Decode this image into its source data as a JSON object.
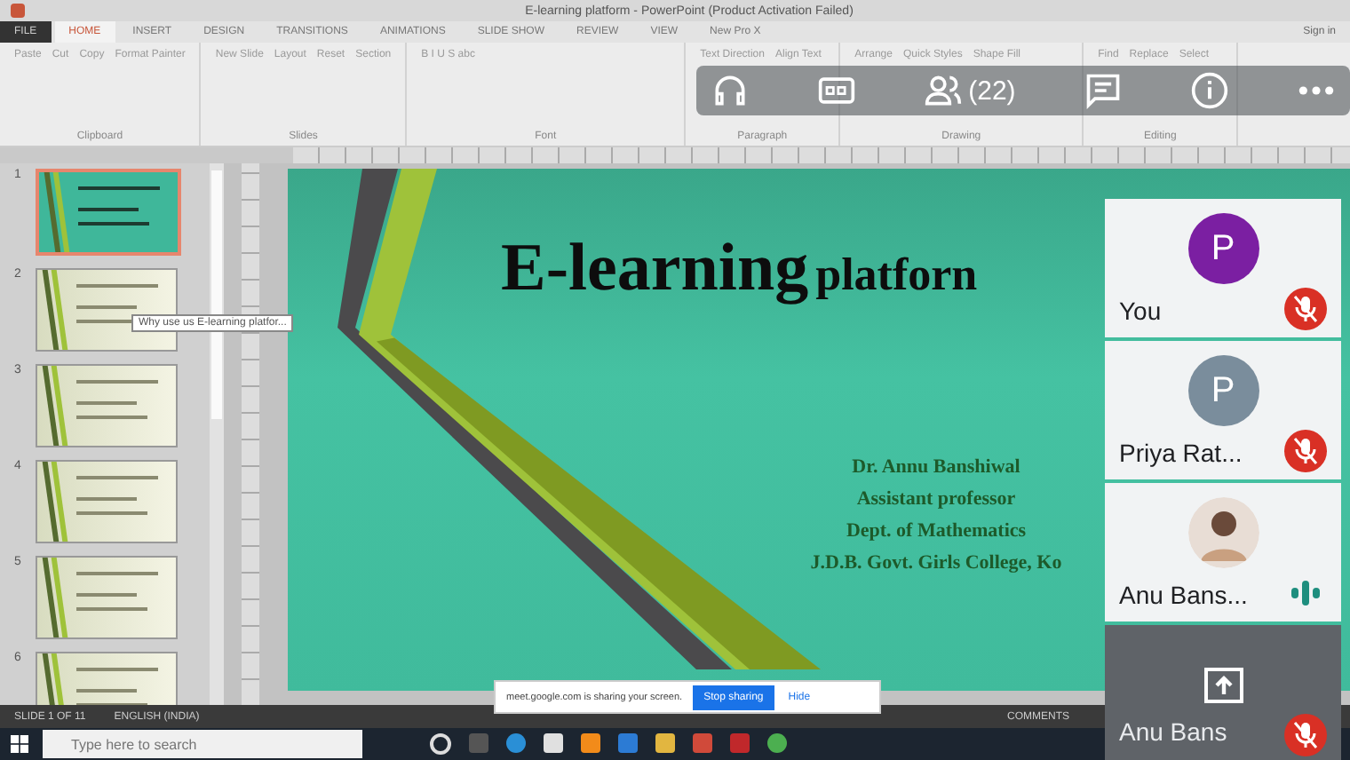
{
  "window": {
    "title": "E-learning platform - PowerPoint (Product Activation Failed)",
    "sign_in": "Sign in"
  },
  "ribbon_tabs": [
    {
      "label": "FILE",
      "selected": false,
      "kind": "file"
    },
    {
      "label": "HOME",
      "selected": true,
      "kind": "tab"
    },
    {
      "label": "INSERT",
      "selected": false,
      "kind": "tab"
    },
    {
      "label": "DESIGN",
      "selected": false,
      "kind": "tab"
    },
    {
      "label": "TRANSITIONS",
      "selected": false,
      "kind": "tab"
    },
    {
      "label": "ANIMATIONS",
      "selected": false,
      "kind": "tab"
    },
    {
      "label": "SLIDE SHOW",
      "selected": false,
      "kind": "tab"
    },
    {
      "label": "REVIEW",
      "selected": false,
      "kind": "tab"
    },
    {
      "label": "VIEW",
      "selected": false,
      "kind": "tab"
    },
    {
      "label": "New Pro X",
      "selected": false,
      "kind": "tab"
    }
  ],
  "ribbon_groups": [
    {
      "label": "Clipboard",
      "buttons": [
        "Paste",
        "Cut",
        "Copy",
        "Format Painter"
      ]
    },
    {
      "label": "Slides",
      "buttons": [
        "New Slide",
        "Layout",
        "Reset",
        "Section"
      ]
    },
    {
      "label": "Font",
      "buttons": [
        "B I U S abc"
      ]
    },
    {
      "label": "Paragraph",
      "buttons": [
        "Text Direction",
        "Align Text"
      ]
    },
    {
      "label": "Drawing",
      "buttons": [
        "Arrange",
        "Quick Styles",
        "Shape Fill"
      ]
    },
    {
      "label": "Editing",
      "buttons": [
        "Find",
        "Replace",
        "Select"
      ]
    }
  ],
  "meet_toolbar": {
    "participant_count": "(22)"
  },
  "thumbnails": [
    {
      "number": "1",
      "selected": true,
      "kind": "title"
    },
    {
      "number": "2",
      "selected": false,
      "kind": "content"
    },
    {
      "number": "3",
      "selected": false,
      "kind": "content"
    },
    {
      "number": "4",
      "selected": false,
      "kind": "content"
    },
    {
      "number": "5",
      "selected": false,
      "kind": "content"
    },
    {
      "number": "6",
      "selected": false,
      "kind": "content"
    }
  ],
  "tooltip": "Why use us E-learning platfor...",
  "slide": {
    "title_big": "E-learning",
    "title_small": "platforn",
    "lines": [
      "Dr. Annu Banshiwal",
      "Assistant professor",
      "Dept. of Mathematics",
      "J.D.B. Govt. Girls College, Ko"
    ]
  },
  "participants": [
    {
      "name": "You",
      "avatar": "P",
      "kind": "letter",
      "color": "#7b1fa2",
      "muted": true
    },
    {
      "name": "Priya Rat...",
      "avatar": "P",
      "kind": "letter",
      "color": "#7a8d9c",
      "muted": true
    },
    {
      "name": "Anu Bans...",
      "kind": "photo",
      "muted": false
    },
    {
      "name": "Anu Bans",
      "kind": "presenting",
      "muted": true
    }
  ],
  "share_bar": {
    "message": "meet.google.com is sharing your screen.",
    "stop": "Stop sharing",
    "hide": "Hide"
  },
  "status_bar": {
    "slide": "SLIDE 1 OF 11",
    "language": "ENGLISH (INDIA)",
    "comments": "COMMENTS"
  },
  "taskbar": {
    "search_placeholder": "Type here to search"
  }
}
